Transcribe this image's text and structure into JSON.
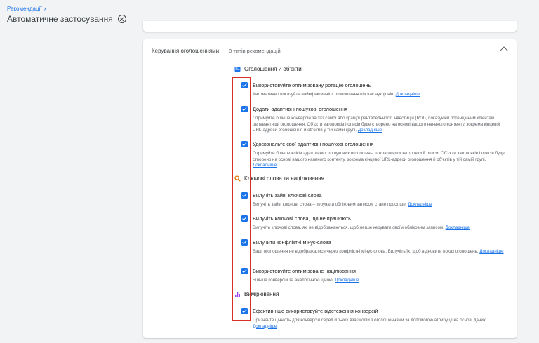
{
  "breadcrumb": {
    "link": "Рекомендації"
  },
  "page": {
    "title": "Автоматичне застосування"
  },
  "card": {
    "title": "Керування оголошеннями",
    "summary": "8 типів рекомендацій"
  },
  "sections": [
    {
      "title": "Оголошення й об'єкти",
      "icon": "ad-icon",
      "color": "#1a73e8"
    },
    {
      "title": "Ключові слова та націлювання",
      "icon": "search-icon",
      "color": "#e37400"
    },
    {
      "title": "Вимірювання",
      "icon": "bar-chart-icon",
      "color": "#a142f4"
    }
  ],
  "items": [
    {
      "title": "Використовуйте оптимізовану ротацію оголошень",
      "desc": "Автоматично показуйте найефективніші оголошення під час аукціонів.",
      "link": "Докладніше"
    },
    {
      "title": "Додати адаптивні пошукові оголошення",
      "desc": "Отримуйте більше конверсій за тієї самої або кращої рентабельності інвестицій (ROI), показуючи потенційним клієнтам релевантніші оголошення. Об'єкти заголовків і описів буде створено на основі вашого наявного контенту, зокрема кінцевої URL-адреси оголошення й об'єктів у тій самій групі.",
      "link": "Докладніше"
    },
    {
      "title": "Удоскональте свої адаптивні пошукові оголошення",
      "desc": "Отримуйте більше кліків адаптивних пошукових оголошень, покращивши заголовки й описи. Об'єкти заголовків і описів буде створено на основі вашого наявного контенту, зокрема кінцевої URL-адреси оголошення й об'єктів у тій самій групі.",
      "link": "Докладніше"
    },
    {
      "title": "Вилучіть зайві ключові слова",
      "desc": "Вилучіть зайві ключові слова – керувати обліковим записом стане простіше.",
      "link": "Докладніше"
    },
    {
      "title": "Вилучіть ключові слова, що не працюють",
      "desc": "Вилучіть ключові слова, які не відображаються, щоб легше керувати своїм обліковим записом.",
      "link": "Докладніше"
    },
    {
      "title": "Вилучити конфліктні мінус-слова",
      "desc": "Ваші оголошення не відображалися через конфліктні мінус-слова. Вилучіть їх, щоб відновити показ оголошень.",
      "link": "Докладніше"
    },
    {
      "title": "Використовуйте оптимізоване націлювання",
      "desc": "Більше конверсій за аналогічною ціною.",
      "link": "Докладніше"
    },
    {
      "title": "Ефективніше використовуйте відстеження конверсій",
      "desc": "Призначте цінність для конверсій серед кількох взаємодій з оголошеннями за допомогою атрибуції на основі даних.",
      "link": "Докладніше"
    }
  ]
}
